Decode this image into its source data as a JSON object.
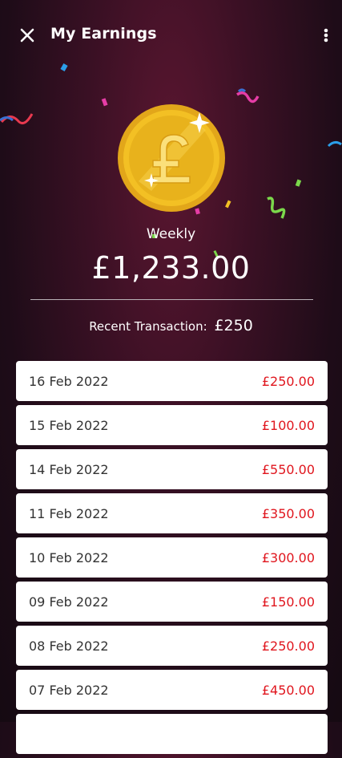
{
  "header": {
    "title": "My Earnings"
  },
  "icons": {
    "close": "close-icon",
    "menu": "more-vert-icon",
    "coin": "pound-coin-icon"
  },
  "earnings": {
    "period": "Weekly",
    "total": "£1,233.00"
  },
  "recent": {
    "label": "Recent Transaction:",
    "amount": "£250"
  },
  "colors": {
    "amount": "#e0161e",
    "background": "#1e0c18",
    "coin": "#f3c024"
  },
  "transactions": [
    {
      "date": "16 Feb 2022",
      "amount": "£250.00"
    },
    {
      "date": "15 Feb 2022",
      "amount": "£100.00"
    },
    {
      "date": "14 Feb 2022",
      "amount": "£550.00"
    },
    {
      "date": "11 Feb 2022",
      "amount": "£350.00"
    },
    {
      "date": "10 Feb 2022",
      "amount": "£300.00"
    },
    {
      "date": "09 Feb 2022",
      "amount": "£150.00"
    },
    {
      "date": "08 Feb 2022",
      "amount": "£250.00"
    },
    {
      "date": "07 Feb 2022",
      "amount": "£450.00"
    },
    {
      "date": "",
      "amount": ""
    }
  ]
}
